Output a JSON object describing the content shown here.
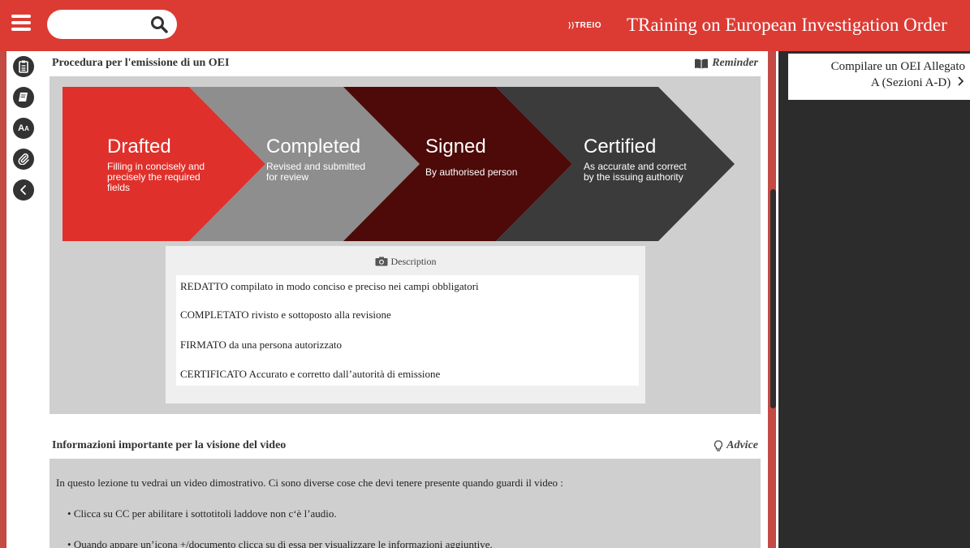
{
  "header": {
    "search": {
      "value": "",
      "placeholder": ""
    },
    "brand_logo": "TREIO",
    "title": "TRaining on European Investigation Order"
  },
  "rail": {
    "icons": [
      "notes-icon",
      "book-icon",
      "text-size-icon",
      "attachment-icon",
      "back-chevron-icon"
    ]
  },
  "section1": {
    "title": "Procedura per l'emissione di un OEI",
    "tag": "Reminder",
    "steps": [
      {
        "name": "Drafted",
        "desc": [
          "Filling in concisely and",
          "precisely the required",
          "fields"
        ],
        "color": "#e0302b"
      },
      {
        "name": "Completed",
        "desc": [
          "Revised and submitted",
          "for review"
        ],
        "color": "#8e8e8e"
      },
      {
        "name": "Signed",
        "desc": [
          "By authorised person"
        ],
        "color": "#4d0a08"
      },
      {
        "name": "Certified",
        "desc": [
          "As accurate and correct",
          "by the issuing authority"
        ],
        "color": "#3b3b3b"
      }
    ],
    "description": {
      "label": "Description",
      "items": [
        "REDATTO compilato in modo conciso e preciso nei campi obbligatori",
        "COMPLETATO rivisto e sottoposto alla revisione",
        "FIRMATO da una persona autorizzato",
        "CERTIFICATO Accurato e corretto dall’autorità di emissione"
      ]
    }
  },
  "section2": {
    "title": "Informazioni importante per la visione del video",
    "tag": "Advice",
    "intro": "In questo lezione tu vedrai un video dimostrativo. Ci sono diverse cose che devi tenere presente quando guardi il video :",
    "bullets": [
      "Clicca su CC per abilitare i sottotitoli laddove non c‘è l’audio.",
      "Quando appare un’icona +/documento clicca su di essa per visualizzare le informazioni aggiuntive."
    ]
  },
  "right_panel": {
    "next_line1": "Compilare un OEI Allegato",
    "next_line2": "A (Sezioni A-D)"
  }
}
